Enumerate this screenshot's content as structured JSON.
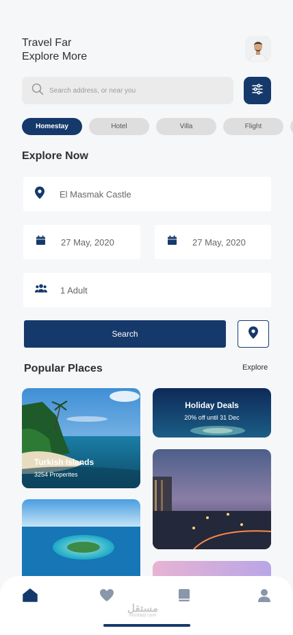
{
  "header": {
    "line1": "Travel Far",
    "line2": "Explore More"
  },
  "search": {
    "placeholder": "Search address, or near you"
  },
  "categories": [
    "Homestay",
    "Hotel",
    "Villa",
    "Flight"
  ],
  "explore": {
    "title": "Explore Now",
    "location": "El Masmak Castle",
    "check_in": "27 May, 2020",
    "check_out": "27 May, 2020",
    "guests": "1 Adult",
    "search_label": "Search"
  },
  "popular": {
    "title": "Popular Places",
    "link": "Explore",
    "cards": [
      {
        "title": "Turkish Islands",
        "subtitle": "3254 Properites"
      },
      {
        "title": "Holiday Deals",
        "subtitle": "20% off until 31 Dec"
      }
    ]
  },
  "watermark": {
    "main": "مستقل",
    "sub": "mostaql.com"
  },
  "colors": {
    "primary": "#16396b",
    "background": "#f6f7f9",
    "chip": "#dedede"
  }
}
